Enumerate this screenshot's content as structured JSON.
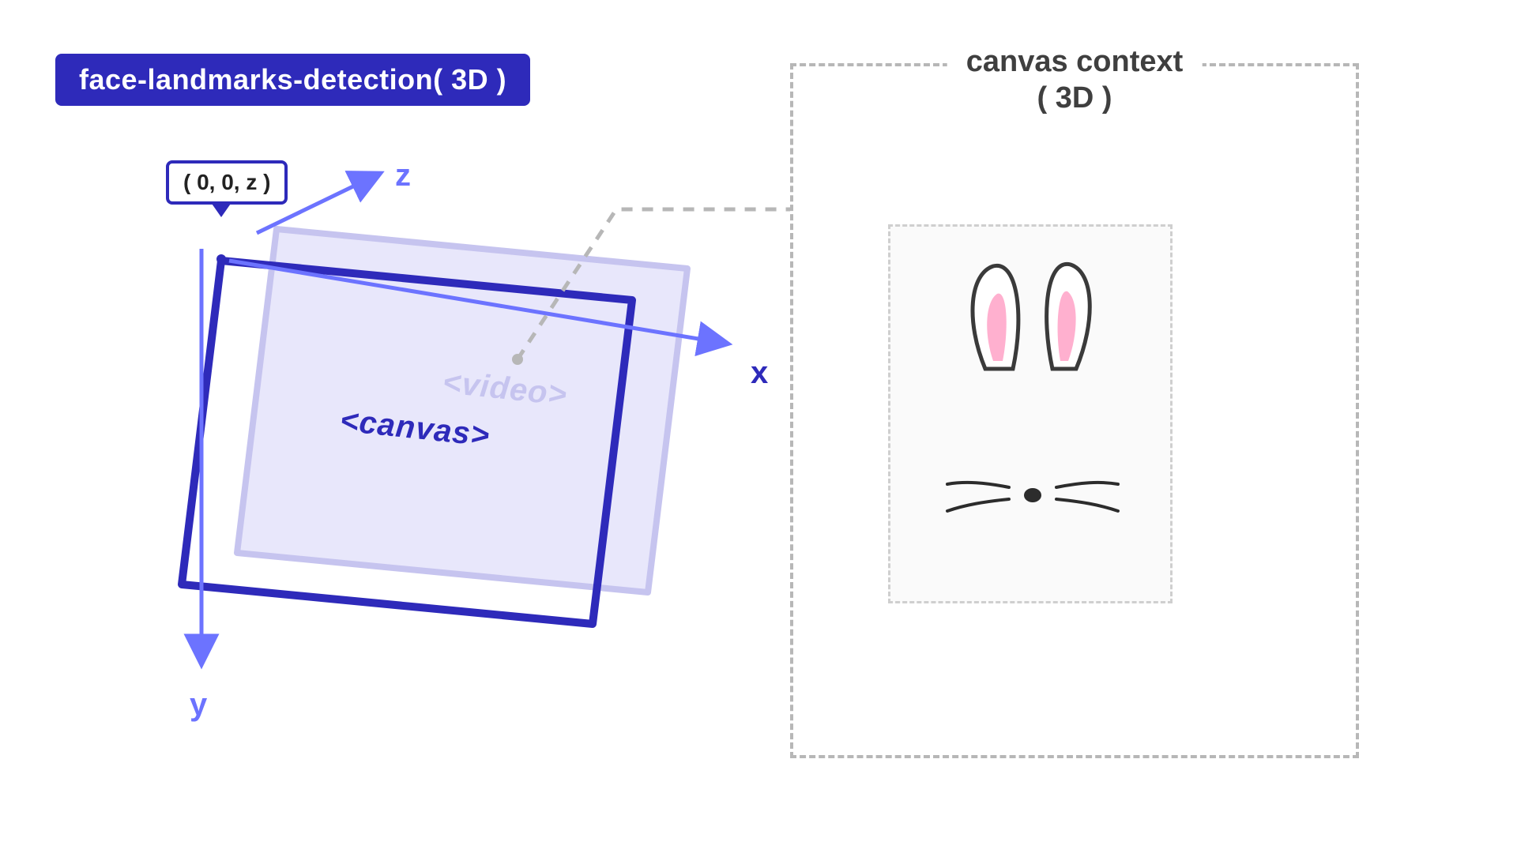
{
  "title": "face-landmarks-detection( 3D )",
  "axes": {
    "x": "x",
    "y": "y",
    "z": "z"
  },
  "origin_label": "( 0, 0, z )",
  "layers": {
    "front": "<canvas>",
    "back": "<video>"
  },
  "canvas_context": {
    "title_line1": "canvas context",
    "title_line2": "( 3D )"
  },
  "colors": {
    "primary": "#2e2aba",
    "accent": "#6c73ff",
    "muted": "#b7b7b7",
    "video_fill": "#e3e2fb",
    "pink": "#ffb0cf"
  }
}
